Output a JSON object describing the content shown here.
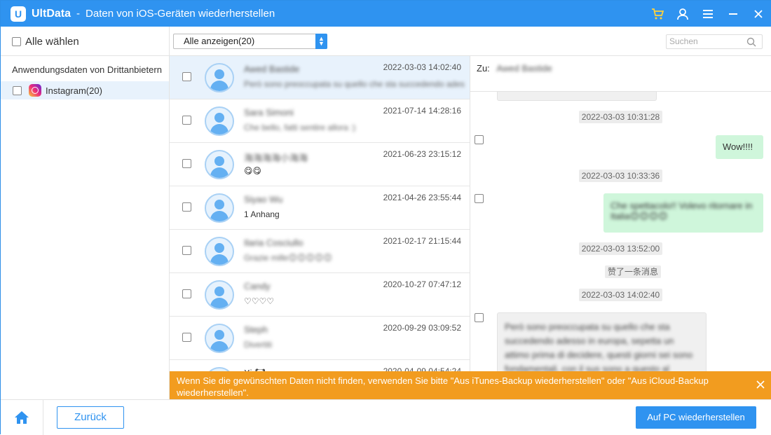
{
  "window": {
    "app_name": "UltData",
    "separator": "-",
    "title": "Daten von iOS-Geräten wiederherstellen",
    "accent": "#2f93f0"
  },
  "titlebar_icons": [
    "cart-icon",
    "user-icon",
    "menu-icon",
    "minimize-icon",
    "close-icon"
  ],
  "sidebar": {
    "select_all_label": "Alle wählen",
    "category_label": "Anwendungsdaten von Drittanbietern",
    "items": [
      {
        "label": "Instagram(20)",
        "icon": "instagram-icon"
      }
    ]
  },
  "toolbar": {
    "filter_value": "Alle anzeigen(20)",
    "search_placeholder": "Suchen"
  },
  "conversations": [
    {
      "name": "Awed Bastide",
      "time": "2022-03-03 14:02:40",
      "preview": "Però sono preoccupata su quello che sta succedendo ades",
      "blur_name": true,
      "blur_preview": true,
      "selected": true
    },
    {
      "name": "Sara Simoni",
      "time": "2021-07-14 14:28:16",
      "preview": "Che bello, fatti sentire allora :)",
      "blur_name": true,
      "blur_preview": true,
      "selected": false
    },
    {
      "name": "海海海海小海海",
      "time": "2021-06-23 23:15:12",
      "preview": "😋😋",
      "blur_name": true,
      "blur_preview": false,
      "selected": false
    },
    {
      "name": "Siyao Wu",
      "time": "2021-04-26 23:55:44",
      "preview": "1 Anhang",
      "blur_name": true,
      "blur_preview": false,
      "selected": false
    },
    {
      "name": "Ilaria Cosciullo",
      "time": "2021-02-17 21:15:44",
      "preview": "Grazie mille😊😊😊😊😊",
      "blur_name": true,
      "blur_preview": true,
      "selected": false
    },
    {
      "name": "Candy",
      "time": "2020-10-27 07:47:12",
      "preview": "♡♡♡♡",
      "blur_name": true,
      "blur_preview": false,
      "selected": false
    },
    {
      "name": "Steph",
      "time": "2020-09-29 03:09:52",
      "preview": "Divertiti",
      "blur_name": true,
      "blur_preview": true,
      "selected": false
    },
    {
      "name": "Xi 🐼",
      "time": "2020-04-09 04:54:24",
      "preview": "",
      "blur_name": false,
      "blur_preview": false,
      "selected": false
    }
  ],
  "chat": {
    "to_label": "Zu:",
    "to_name": "Awed Bastide",
    "items": [
      {
        "kind": "stamp",
        "text": "2022-03-03 10:31:28"
      },
      {
        "kind": "out",
        "text": "Wow!!!!"
      },
      {
        "kind": "stamp",
        "text": "2022-03-03 10:33:36"
      },
      {
        "kind": "out",
        "text": "Che spettacolo!! Volevo ritornare in Italia😊😊😊😊"
      },
      {
        "kind": "stamp",
        "text": "2022-03-03 13:52:00"
      },
      {
        "kind": "notice",
        "text": "赞了一条消息"
      },
      {
        "kind": "stamp",
        "text": "2022-03-03 14:02:40"
      },
      {
        "kind": "in",
        "text": "Però sono preoccupata su quello che sta succedendo adesso in europa, sepetta un attimo prima di decidere, questi giorni sei sono fondamentali, con il sus sono a questo al"
      }
    ]
  },
  "banner": {
    "text": "Wenn Sie die gewünschten Daten nicht finden, verwenden Sie bitte \"Aus iTunes-Backup wiederherstellen\" oder \"Aus iCloud-Backup wiederherstellen\".",
    "color": "#f29c1f"
  },
  "footer": {
    "back_label": "Zurück",
    "restore_label": "Auf PC wiederherstellen"
  }
}
